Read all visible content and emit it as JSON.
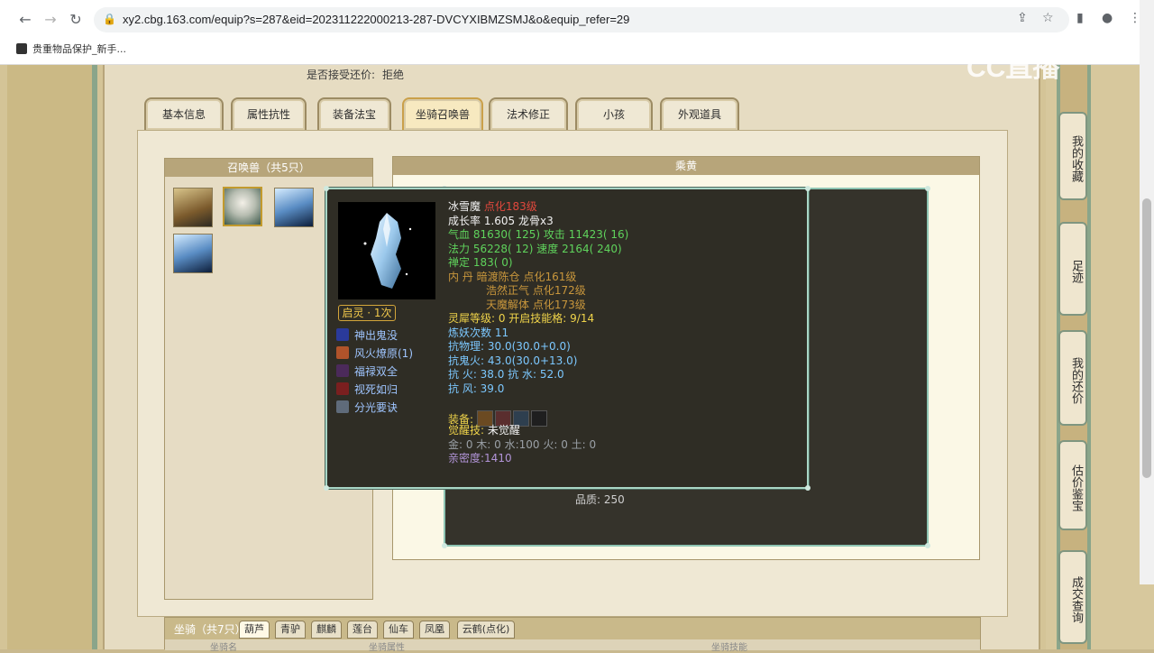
{
  "browser": {
    "url": "xy2.cbg.163.com/equip?s=287&eid=202311222000213-287-DVCYXIBMZSMJ&o&equip_refer=29",
    "bookmark": "贵重物品保护_新手..."
  },
  "watermark": "CC直播",
  "accept": {
    "label": "是否接受还价:",
    "value": "拒绝"
  },
  "tabs": [
    "基本信息",
    "属性抗性",
    "装备法宝",
    "坐骑召唤兽",
    "法术修正",
    "小孩",
    "外观道具"
  ],
  "summon_box": {
    "title": "召唤兽（共5只）"
  },
  "riding_box": {
    "title": "乘黄"
  },
  "back_panel": {
    "quality": "品质:  250"
  },
  "tooltip": {
    "name": "冰雪魔",
    "rank": "点化183级",
    "growth": "成长率 1.605 龙骨x3",
    "hp_atk": "气血 81630( 125) 攻击 11423( 16)",
    "mp_spd": "法力 56228( 12) 速度 2164( 240)",
    "ding": "禅定 183( 0)",
    "dan1": "内    丹  暗渡陈仓 点化161级",
    "dan2": "浩然正气 点化172级",
    "dan3": "天魔解体 点化173级",
    "lingxi": "灵犀等级:  0 开启技能格:  9/14",
    "lianyao": "炼妖次数 11",
    "kang_wuli": "抗物理: 30.0(30.0+0.0)",
    "kang_gui": "抗鬼火: 43.0(30.0+13.0)",
    "kang_huo_shui": "抗    火: 38.0 抗    水: 52.0",
    "kang_feng": "抗    风: 39.0",
    "equip_label": "装备:",
    "awaken_label": "觉醒技:",
    "awaken_value": "未觉醒",
    "elements": "金: 0 木: 0 水:100 火: 0 土: 0",
    "intimacy": "亲密度:1410",
    "qiling": "启灵 · 1次",
    "skills": [
      {
        "name": "神出鬼没",
        "icon": "ghost-skill-icon"
      },
      {
        "name": "风火燎原(1)",
        "icon": "fire-skill-icon"
      },
      {
        "name": "福禄双全",
        "icon": "fortune-skill-icon"
      },
      {
        "name": "视死如归",
        "icon": "death-skill-icon"
      },
      {
        "name": "分光要诀",
        "icon": "split-light-skill-icon"
      }
    ]
  },
  "side_buttons": [
    "我的收藏",
    "足迹",
    "我的还价",
    "估价鉴宝",
    "成交查询"
  ],
  "bottom": {
    "title": "坐骑（共7只）",
    "tabs": [
      "葫芦",
      "青驴",
      "麒麟",
      "莲台",
      "仙车",
      "凤凰",
      "云鹤(点化)"
    ],
    "col1": "坐骑名",
    "col2": "坐骑属性",
    "col3": "坐骑技能"
  },
  "colors": {
    "tooltip_bg": "#2f2d25",
    "tooltip_border": "#a8d6c6",
    "tab_active": "#f7e9c0"
  }
}
